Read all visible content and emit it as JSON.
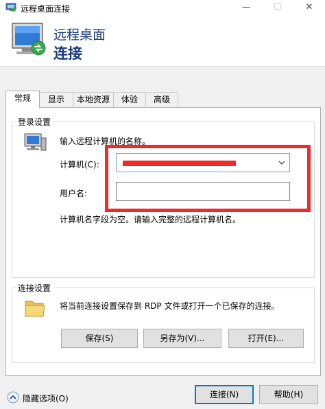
{
  "window": {
    "title": "远程桌面连接",
    "minimize_glyph": "—",
    "maximize_glyph": "☐",
    "close_glyph": "✕",
    "app_icon": "remote-desktop-icon"
  },
  "header": {
    "line1": "远程桌面",
    "line2": "连接",
    "icon": "monitor-remote-icon"
  },
  "tabs": [
    {
      "label": "常规"
    },
    {
      "label": "显示"
    },
    {
      "label": "本地资源"
    },
    {
      "label": "体验"
    },
    {
      "label": "高级"
    }
  ],
  "logon": {
    "group_title": "登录设置",
    "instruction": "输入远程计算机的名称。",
    "computer_label": "计算机(C):",
    "computer_value": "",
    "username_label": "用户名:",
    "username_value": "",
    "error_text": "计算机名字段为空。请输入完整的远程计算机名。",
    "icon": "computer-icon"
  },
  "connection": {
    "group_title": "连接设置",
    "description": "将当前连接设置保存到 RDP 文件或打开一个已保存的连接。",
    "save_label": "保存(S)",
    "save_as_label": "另存为(V)...",
    "open_label": "打开(E)...",
    "icon": "folder-icon"
  },
  "footer": {
    "hide_options_label": "隐藏选项(O)",
    "connect_label": "连接(N)",
    "help_label": "帮助(H)"
  },
  "colors": {
    "header_text": "#1a3a7a",
    "annotation_red": "#ee2b2b",
    "primary_border": "#0078d7"
  }
}
